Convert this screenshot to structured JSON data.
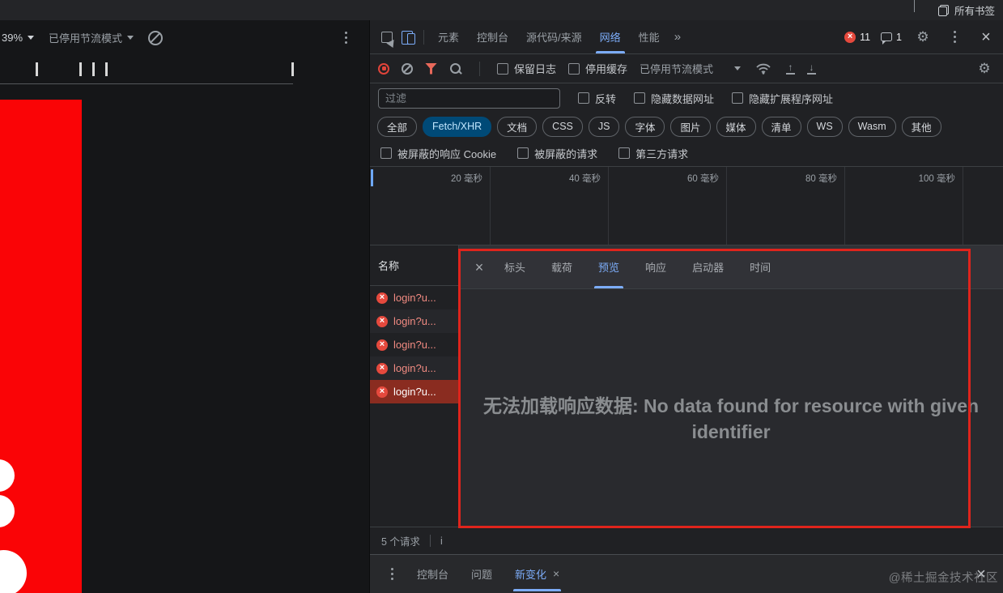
{
  "browser": {
    "all_bookmarks": "所有书签"
  },
  "device_toolbar": {
    "zoom": "39%",
    "throttle": "已停用节流模式"
  },
  "main_tabs": {
    "items": [
      "元素",
      "控制台",
      "源代码/来源",
      "网络",
      "性能"
    ],
    "active": "网络",
    "more": "»",
    "error_count": "11",
    "issue_count": "1"
  },
  "net_toolbar": {
    "preserve_log": "保留日志",
    "disable_cache": "停用缓存",
    "throttle": "已停用节流模式"
  },
  "filter_row": {
    "placeholder": "过滤",
    "invert": "反转",
    "hide_data_urls": "隐藏数据网址",
    "hide_extension_urls": "隐藏扩展程序网址"
  },
  "chips": {
    "items": [
      "全部",
      "Fetch/XHR",
      "文档",
      "CSS",
      "JS",
      "字体",
      "图片",
      "媒体",
      "清单",
      "WS",
      "Wasm",
      "其他"
    ],
    "active": "Fetch/XHR"
  },
  "blocked_row": {
    "blocked_cookies": "被屏蔽的响应 Cookie",
    "blocked_requests": "被屏蔽的请求",
    "third_party": "第三方请求"
  },
  "timeline": {
    "ticks": [
      "20 毫秒",
      "40 毫秒",
      "60 毫秒",
      "80 毫秒",
      "100 毫秒"
    ]
  },
  "requests": {
    "header": "名称",
    "rows": [
      {
        "name": "login?u..."
      },
      {
        "name": "login?u..."
      },
      {
        "name": "login?u..."
      },
      {
        "name": "login?u..."
      },
      {
        "name": "login?u..."
      }
    ],
    "selected_index": 4,
    "summary": "5 个请求",
    "summary_partial": "i"
  },
  "details": {
    "tabs": [
      "标头",
      "载荷",
      "预览",
      "响应",
      "启动器",
      "时间"
    ],
    "active": "预览",
    "message": "无法加载响应数据: No data found for resource with given identifier"
  },
  "drawer": {
    "tabs": [
      "控制台",
      "问题",
      "新变化"
    ],
    "active": "新变化"
  },
  "watermark": "@稀土掘金技术社区",
  "colors": {
    "accent_blue": "#7cacf8",
    "error_red": "#e5493d",
    "annotation_red": "#df241c",
    "selected_row_red": "#8a2c20",
    "page_red": "#fa0406",
    "chip_active_bg": "#004a77"
  }
}
